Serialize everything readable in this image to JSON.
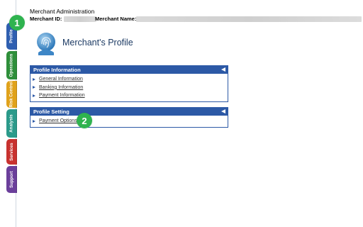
{
  "header": {
    "title": "Merchant Administration",
    "merchant_id_label": "Merchant ID:",
    "merchant_name_label": "Merchant Name:"
  },
  "tabs": [
    {
      "label": "Profile",
      "color": "#2f5fb0"
    },
    {
      "label": "Operations",
      "color": "#2e8f3a"
    },
    {
      "label": "Risk Control",
      "color": "#e0a21b"
    },
    {
      "label": "Analysis",
      "color": "#2b9a8a"
    },
    {
      "label": "Services",
      "color": "#c8322f"
    },
    {
      "label": "Support",
      "color": "#6b3f9b"
    }
  ],
  "page": {
    "title": "Merchant's Profile",
    "logo_icon": "fingerprint-icon"
  },
  "callouts": [
    "1",
    "2"
  ],
  "panels": [
    {
      "title": "Profile Information",
      "items": [
        "General Information",
        "Banking Information",
        "Payment Information"
      ]
    },
    {
      "title": "Profile Setting",
      "items": [
        "Payment Options"
      ]
    }
  ],
  "colors": {
    "panel_header": "#2c59a6",
    "callout": "#2fb34f"
  }
}
